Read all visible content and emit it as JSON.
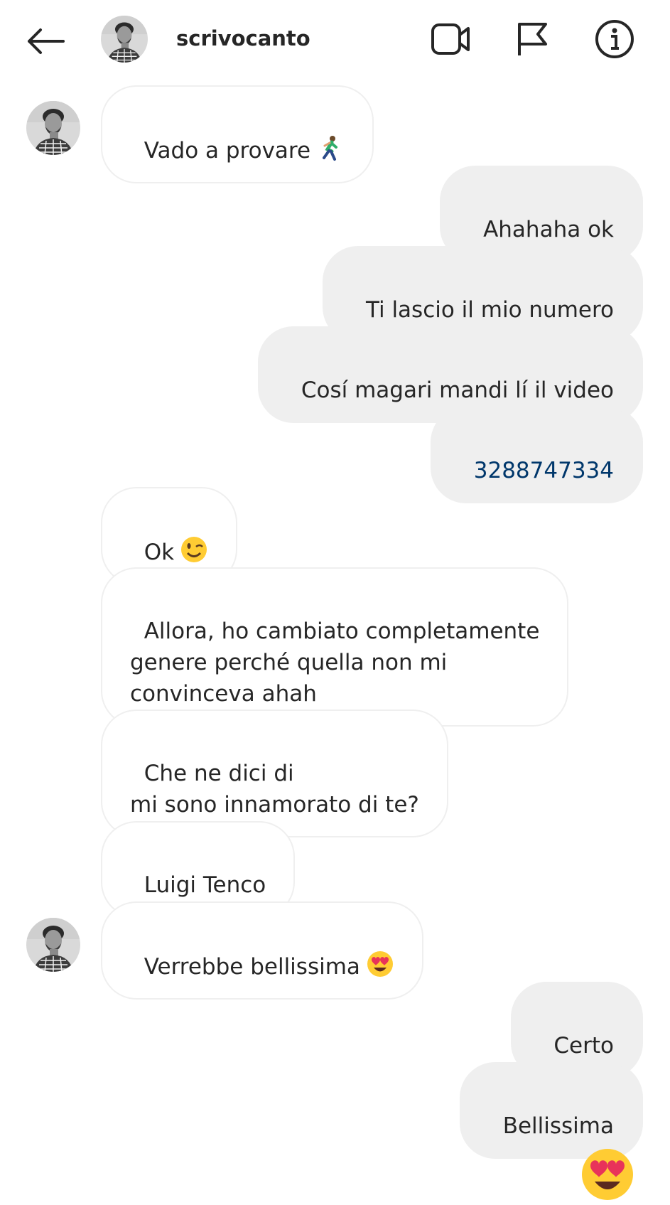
{
  "header": {
    "back_icon": "arrow-left-icon",
    "username": "scrivocanto",
    "icons": [
      "video-camera-icon",
      "flag-icon",
      "info-icon"
    ]
  },
  "messages": [
    {
      "side": "received",
      "text": "Vado a provare",
      "emoji": "running-person-emoji"
    },
    {
      "side": "sent",
      "text": "Ahahaha ok"
    },
    {
      "side": "sent",
      "text": "Ti lascio il mio numero"
    },
    {
      "side": "sent",
      "text": "Cosí magari mandi lí il video"
    },
    {
      "side": "sent",
      "text": "3288747334",
      "link": true
    },
    {
      "side": "received",
      "text": "Ok",
      "emoji": "winking-face-emoji"
    },
    {
      "side": "received",
      "text": "Allora, ho cambiato completamente\ngenere perché quella non mi\nconvinceva ahah"
    },
    {
      "side": "received",
      "text": "Che ne dici di\nmi sono innamorato di te?"
    },
    {
      "side": "received",
      "text": "Luigi Tenco"
    },
    {
      "side": "received",
      "text": "Verrebbe bellissima",
      "emoji": "heart-eyes-emoji"
    },
    {
      "side": "sent",
      "text": "Certo"
    },
    {
      "side": "sent",
      "text": "Bellissima"
    }
  ],
  "last_sent_emoji": "heart-eyes-emoji",
  "colors": {
    "sent_bubble": "#efefef",
    "received_border": "#efefef",
    "text": "#262626",
    "link": "#00376b"
  }
}
